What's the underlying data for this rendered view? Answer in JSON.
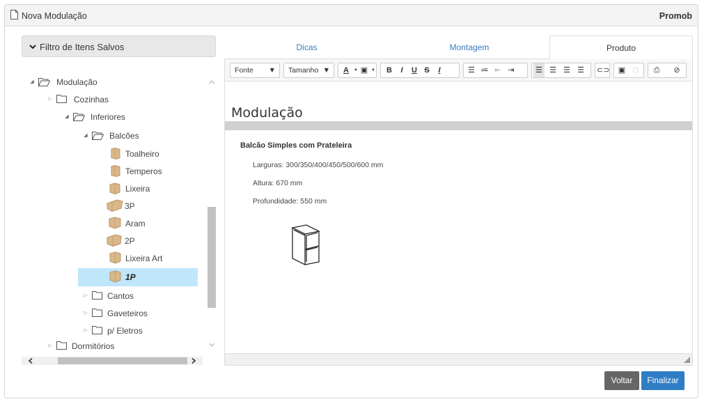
{
  "window": {
    "title": "Nova Modulação",
    "brand": "Promob"
  },
  "filter": {
    "label": "Filtro de Itens Salvos"
  },
  "tree": {
    "root": "Modulação",
    "cozinhas": "Cozinhas",
    "inferiores": "Inferiores",
    "balcoes": "Balcões",
    "items": [
      "Toalheiro",
      "Temperos",
      "Lixeira",
      "3P",
      "Aram",
      "2P",
      "Lixeira Art",
      "1P"
    ],
    "cantos": "Cantos",
    "gaveteiros": "Gaveteiros",
    "eletros": "p/ Eletros",
    "dormitorios": "Dormitórios"
  },
  "tabs": [
    "Dicas",
    "Montagem",
    "Produto"
  ],
  "toolbar": {
    "font": "Fonte",
    "size": "Tamanho"
  },
  "document": {
    "heading": "Modulação",
    "product_title": "Balcão Simples com Prateleira",
    "widths": "Larguras: 300/350/400/450/500/600 mm",
    "height": "Altura: 670 mm",
    "depth": "Profundidade: 550 mm"
  },
  "buttons": {
    "back": "Voltar",
    "finish": "Finalizar"
  },
  "colors": {
    "accent": "#2f7dc4",
    "selection": "#bfe6fb",
    "tab_link": "#3c7bbf"
  }
}
